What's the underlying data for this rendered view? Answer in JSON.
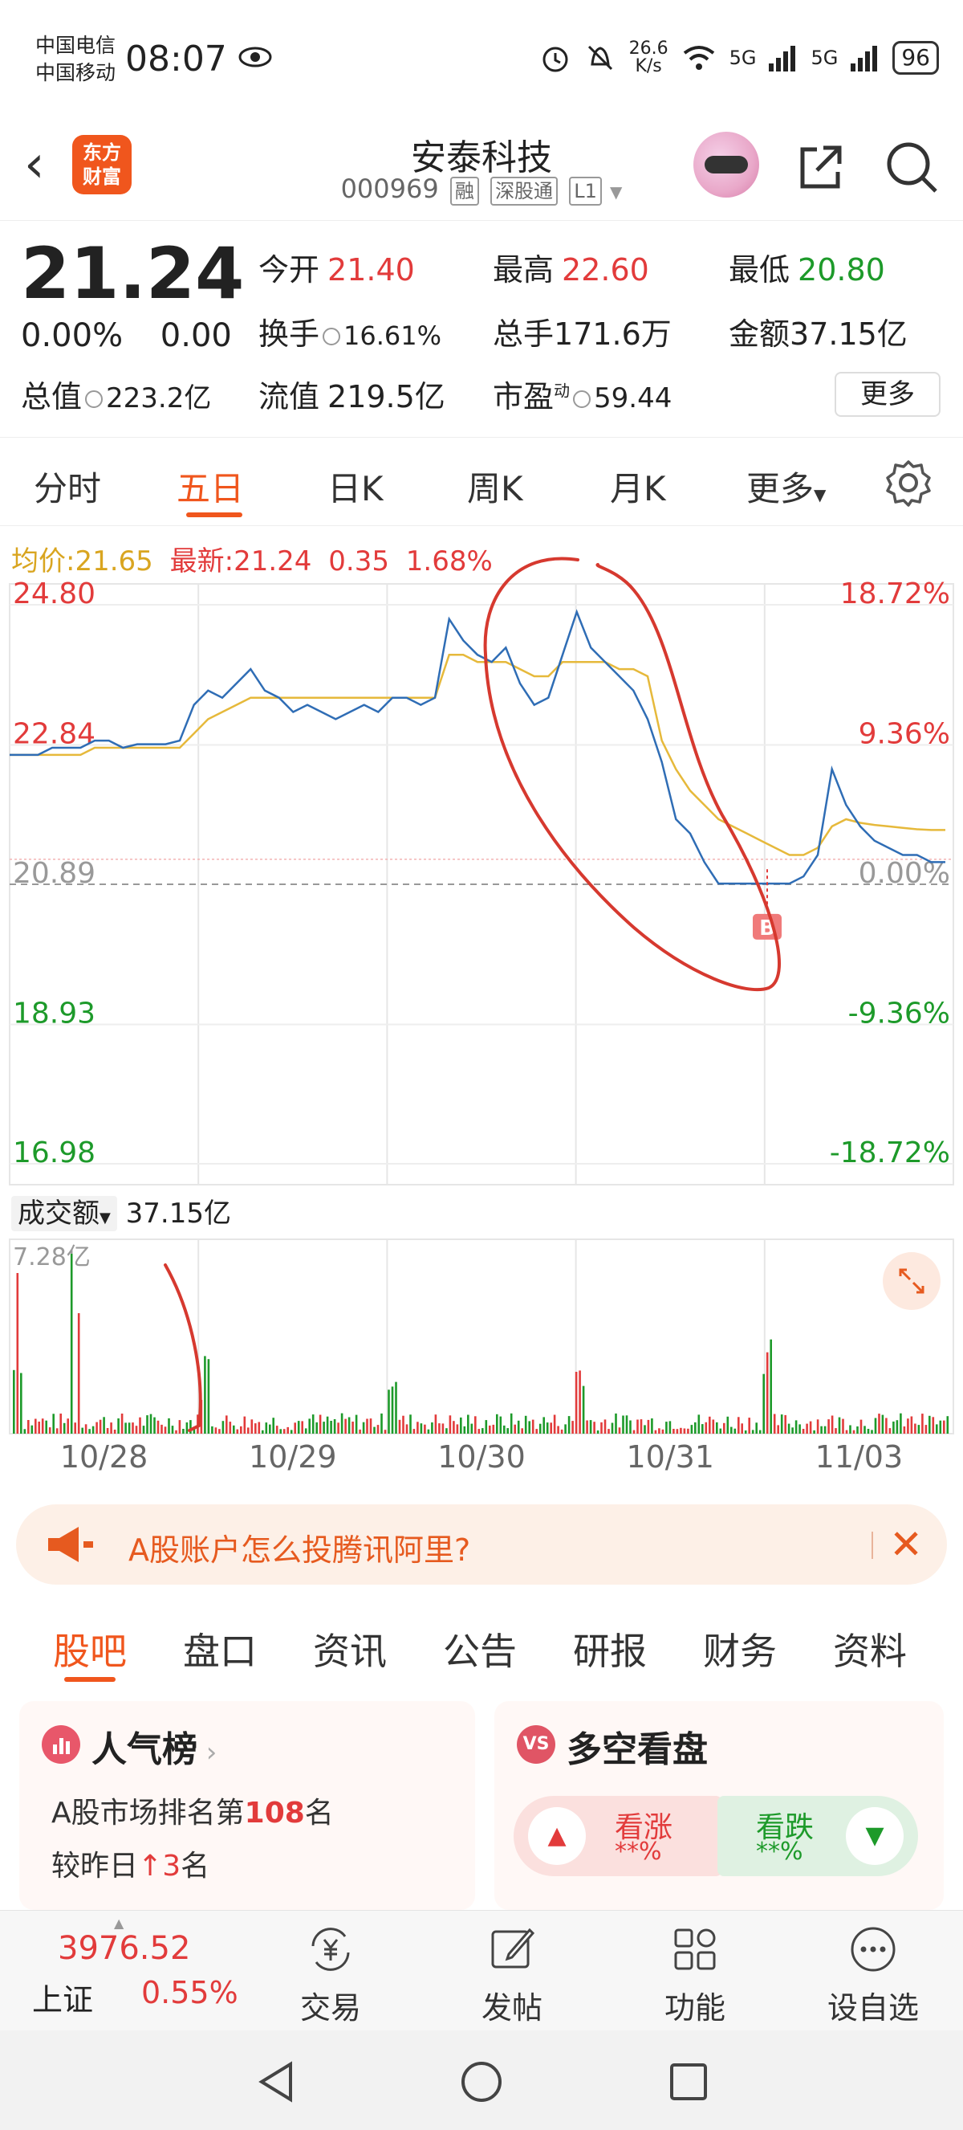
{
  "status_bar": {
    "carrier1": "中国电信",
    "carrier2": "中国移动",
    "time": "08:07",
    "net_speed_value": "26.6",
    "net_speed_unit": "K/s",
    "signal1": "5G",
    "signal2": "5G",
    "battery": "96"
  },
  "header": {
    "logo_line1": "东方",
    "logo_line2": "财富",
    "stock_name": "安泰科技",
    "stock_code": "000969",
    "tags": [
      "融",
      "深股通",
      "L1"
    ]
  },
  "quote": {
    "price": "21.24",
    "change_pct": "0.00%",
    "change_abs": "0.00",
    "open_label": "今开",
    "open": "21.40",
    "high_label": "最高",
    "high": "22.60",
    "low_label": "最低",
    "low": "20.80",
    "turnover_label": "换手",
    "turnover": "16.61%",
    "volume_label": "总手",
    "volume": "171.6万",
    "amount_label": "金额",
    "amount": "37.15亿",
    "mktcap_label": "总值",
    "mktcap": "223.2亿",
    "float_label": "流值",
    "float_cap": "219.5亿",
    "pe_label": "市盈",
    "pe_sup": "动",
    "pe": "59.44",
    "more_label": "更多"
  },
  "tabs": {
    "items": [
      "分时",
      "五日",
      "日K",
      "周K",
      "月K",
      "更多"
    ],
    "active": "五日"
  },
  "chart": {
    "avg_label": "均价:",
    "avg_value": "21.65",
    "latest_label": "最新:",
    "latest_value": "21.24",
    "latest_change": "0.35",
    "latest_pct": "1.68%",
    "volume_selector": "成交额",
    "volume_total": "37.15亿",
    "volume_max": "7.28亿",
    "buy_marker": "B",
    "colors": {
      "price_line": "#2f6db5",
      "avg_line": "#e6b93b",
      "up": "#e23b3b",
      "down": "#1d9a2a",
      "annotation": "#d6392f"
    }
  },
  "chart_data": {
    "type": "line",
    "title": "",
    "x": [
      "10/28",
      "10/29",
      "10/30",
      "10/31",
      "11/03"
    ],
    "y_left_ticks": [
      "24.80",
      "22.84",
      "20.89",
      "18.93",
      "16.98"
    ],
    "y_right_ticks": [
      "18.72%",
      "9.36%",
      "0.00%",
      "-9.36%",
      "-18.72%"
    ],
    "ylim": [
      16.98,
      24.8
    ],
    "reference_close": 20.89,
    "series": [
      {
        "values": [
          22.7,
          22.7,
          22.7,
          22.8,
          22.8,
          22.8,
          22.9,
          22.9,
          22.8,
          22.85,
          22.85,
          22.85,
          22.9,
          23.4,
          23.6,
          23.5,
          23.7,
          23.9,
          23.6,
          23.5,
          23.3,
          23.4,
          23.3,
          23.2,
          23.3,
          23.4,
          23.3,
          23.5,
          23.5,
          23.4,
          23.5,
          24.6,
          24.3,
          24.1,
          24.0,
          24.2,
          23.7,
          23.4,
          23.5,
          24.1,
          24.7,
          24.2,
          24.0,
          23.8,
          23.6,
          23.2,
          22.6,
          21.8,
          21.6,
          21.2,
          20.9,
          20.9,
          20.9,
          20.9,
          20.9,
          20.9,
          21.0,
          21.3,
          22.5,
          22.0,
          21.7,
          21.5,
          21.4,
          21.3,
          21.3,
          21.2,
          21.2
        ]
      },
      {
        "values": [
          22.7,
          22.7,
          22.7,
          22.7,
          22.7,
          22.7,
          22.8,
          22.8,
          22.8,
          22.8,
          22.8,
          22.8,
          22.8,
          23.0,
          23.2,
          23.3,
          23.4,
          23.5,
          23.5,
          23.5,
          23.5,
          23.5,
          23.5,
          23.5,
          23.5,
          23.5,
          23.5,
          23.5,
          23.5,
          23.5,
          23.5,
          24.1,
          24.1,
          24.0,
          24.0,
          24.0,
          23.9,
          23.8,
          23.8,
          24.0,
          24.0,
          24.0,
          24.0,
          23.9,
          23.9,
          23.8,
          22.9,
          22.5,
          22.2,
          22.0,
          21.8,
          21.7,
          21.6,
          21.5,
          21.4,
          21.3,
          21.3,
          21.4,
          21.7,
          21.8,
          21.75,
          21.72,
          21.7,
          21.68,
          21.66,
          21.65,
          21.65
        ]
      }
    ]
  },
  "ad": {
    "text": "A股账户怎么投腾讯阿里?"
  },
  "bottom_tabs": {
    "items": [
      "股吧",
      "盘口",
      "资讯",
      "公告",
      "研报",
      "财务",
      "资料"
    ],
    "active": "股吧"
  },
  "popularity_card": {
    "title": "人气榜",
    "rank_prefix": "A股市场排名第",
    "rank_value": "108",
    "rank_suffix": "名",
    "change_prefix": "较昨日",
    "change_value": "3",
    "change_suffix": "名"
  },
  "sentiment_card": {
    "title": "多空看盘",
    "icon_text": "VS",
    "bull_label": "看涨",
    "bull_value": "**%",
    "bear_label": "看跌",
    "bear_value": "**%"
  },
  "bottom_nav": {
    "index_value": "3976.52",
    "index_name": "上证",
    "index_change": "0.55%",
    "items": [
      {
        "label": "交易",
        "icon": "yen-exchange-icon"
      },
      {
        "label": "发帖",
        "icon": "edit-icon"
      },
      {
        "label": "功能",
        "icon": "grid-icon"
      },
      {
        "label": "设自选",
        "icon": "more-dots-icon"
      }
    ]
  }
}
